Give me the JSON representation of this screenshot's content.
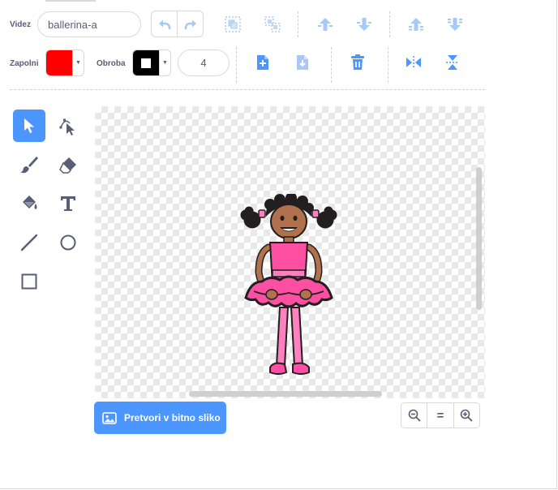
{
  "costume": {
    "name_label": "Videz",
    "name_value": "ballerina-a"
  },
  "fill": {
    "label": "Zapolni",
    "color": "#ff0000"
  },
  "outline": {
    "label": "Obroba",
    "color": "#000000",
    "width": "4"
  },
  "toolbar": {
    "icons": [
      "undo-icon",
      "redo-icon",
      "group-icon",
      "ungroup-icon",
      "forward-icon",
      "backward-icon",
      "front-icon",
      "back-icon",
      "copy-icon",
      "paste-icon",
      "delete-icon",
      "flip-horizontal-icon",
      "flip-vertical-icon"
    ]
  },
  "tools": [
    "select",
    "reshape",
    "brush",
    "eraser",
    "fill",
    "text",
    "line",
    "circle",
    "rectangle"
  ],
  "active_tool": "select",
  "convert_button": {
    "label": "Pretvori v bitno sliko"
  },
  "zoom": {
    "reset_label": "="
  },
  "accent_color": "#4c97ff"
}
